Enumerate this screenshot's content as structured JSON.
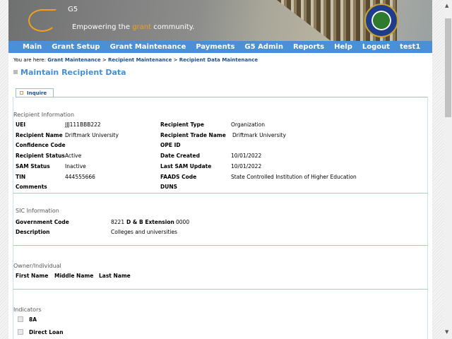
{
  "header": {
    "logo_text": "G5",
    "tagline_pre": "Empowering the ",
    "tagline_hl": "grant",
    "tagline_post": " community.",
    "seal": "U.S. Department of Education seal"
  },
  "nav": [
    "Main",
    "Grant Setup",
    "Grant Maintenance",
    "Payments",
    "G5 Admin",
    "Reports",
    "Help",
    "Logout",
    "test1"
  ],
  "breadcrumb": {
    "prefix": "You are here: ",
    "items": [
      "Grant Maintenance",
      "Recipient Maintenance",
      "Recipient Data Maintenance"
    ],
    "sep": " > "
  },
  "page_title": "Maintain Recipient Data",
  "tab": "Inquire",
  "recipient": {
    "heading": "Recipient Information",
    "left": [
      [
        "UEI",
        "JJJ111BBB222"
      ],
      [
        "Recipient Name",
        "Driftmark University"
      ],
      [
        "Confidence Code",
        ""
      ],
      [
        "Recipient Status",
        "Active"
      ],
      [
        "SAM Status",
        "Inactive"
      ],
      [
        "TIN",
        "444555666"
      ],
      [
        "Comments",
        ""
      ]
    ],
    "right": [
      [
        "Recipient Type",
        "Organization"
      ],
      [
        "Recipient Trade Name",
        "Driftmark University"
      ],
      [
        "OPE ID",
        ""
      ],
      [
        "Date Created",
        "10/01/2022"
      ],
      [
        "Last SAM Update",
        "10/01/2022"
      ],
      [
        "FAADS Code",
        "State Controlled Institution of Higher Education"
      ],
      [
        "DUNS",
        ""
      ]
    ]
  },
  "sic": {
    "heading": "SIC Information",
    "gov_label": "Government Code",
    "gov_value": "8221",
    "ext_label": "D & B Extension",
    "ext_value": "0000",
    "desc_label": "Description",
    "desc_value": "Colleges and universities"
  },
  "owner": {
    "heading": "Owner/Individual",
    "cols": [
      "First Name",
      "Middle Name",
      "Last Name"
    ]
  },
  "indicators": {
    "heading": "Indicators",
    "items": [
      {
        "label": "8A",
        "checked": false
      },
      {
        "label": "Direct Loan",
        "checked": false
      }
    ]
  },
  "colors": {
    "nav": "#4a90d6",
    "title": "#4a8ed0",
    "link": "#1c4f8c",
    "accent": "#f0a020"
  }
}
